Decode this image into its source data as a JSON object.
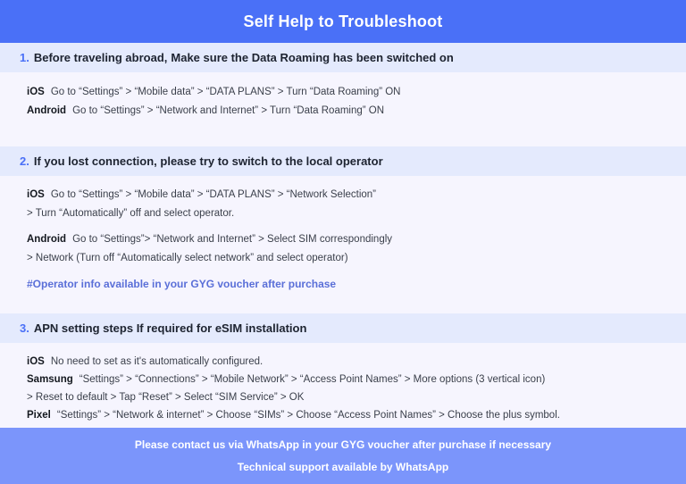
{
  "header": {
    "title": "Self Help to Troubleshoot",
    "bg_color": "#4a70f7",
    "text_color": "#ffffff"
  },
  "theme": {
    "page_bg": "#f6f5fe",
    "band_bg": "#e4eafd",
    "accent": "#4a70f7",
    "note_color": "#5a6fd8",
    "footer_bg": "#7b95fb"
  },
  "sections": [
    {
      "number": "1.",
      "heading_strong": "Before traveling abroad,",
      "heading_rest": "Make sure the Data Roaming has been switched on",
      "rows": [
        {
          "platform": "iOS",
          "steps": "Go to “Settings” > “Mobile data” > “DATA PLANS” > Turn “Data Roaming” ON"
        },
        {
          "platform": "Android",
          "steps": "Go to “Settings” > “Network and Internet” > Turn “Data Roaming” ON"
        }
      ]
    },
    {
      "number": "2.",
      "heading_strong": "If you lost connection, please try to switch to the local operator",
      "heading_rest": "",
      "rows": [
        {
          "platform": "iOS",
          "steps": "Go to “Settings” > “Mobile data” > “DATA PLANS” > “Network Selection”",
          "continuation": "> Turn “Automatically” off and select operator."
        },
        {
          "platform": "Android",
          "steps": "Go to “Settings”>  “Network and Internet” > Select SIM correspondingly",
          "continuation": "> Network (Turn off “Automatically select network” and select operator)"
        }
      ],
      "note": "#Operator info available in your GYG voucher after purchase"
    },
    {
      "number": "3.",
      "heading_strong": "APN setting steps If required for eSIM installation",
      "heading_rest": "",
      "rows": [
        {
          "platform": "iOS",
          "steps": "No need to set as it's automatically configured."
        },
        {
          "platform": "Samsung",
          "steps": "“Settings” > “Connections” > “Mobile Network” > “Access Point Names” > More options (3 vertical icon)",
          "continuation": "> Reset to default > Tap “Reset” > Select “SIM Service” > OK"
        },
        {
          "platform": "Pixel",
          "steps": "“Settings” > “Network & internet” > Choose “SIMs” > Choose “Access Point Names” > Choose the plus symbol."
        }
      ]
    }
  ],
  "footer": {
    "line1": "Please contact us via WhatsApp  in your GYG voucher after purchase if necessary",
    "line2": "Technical support available by WhatsApp"
  }
}
